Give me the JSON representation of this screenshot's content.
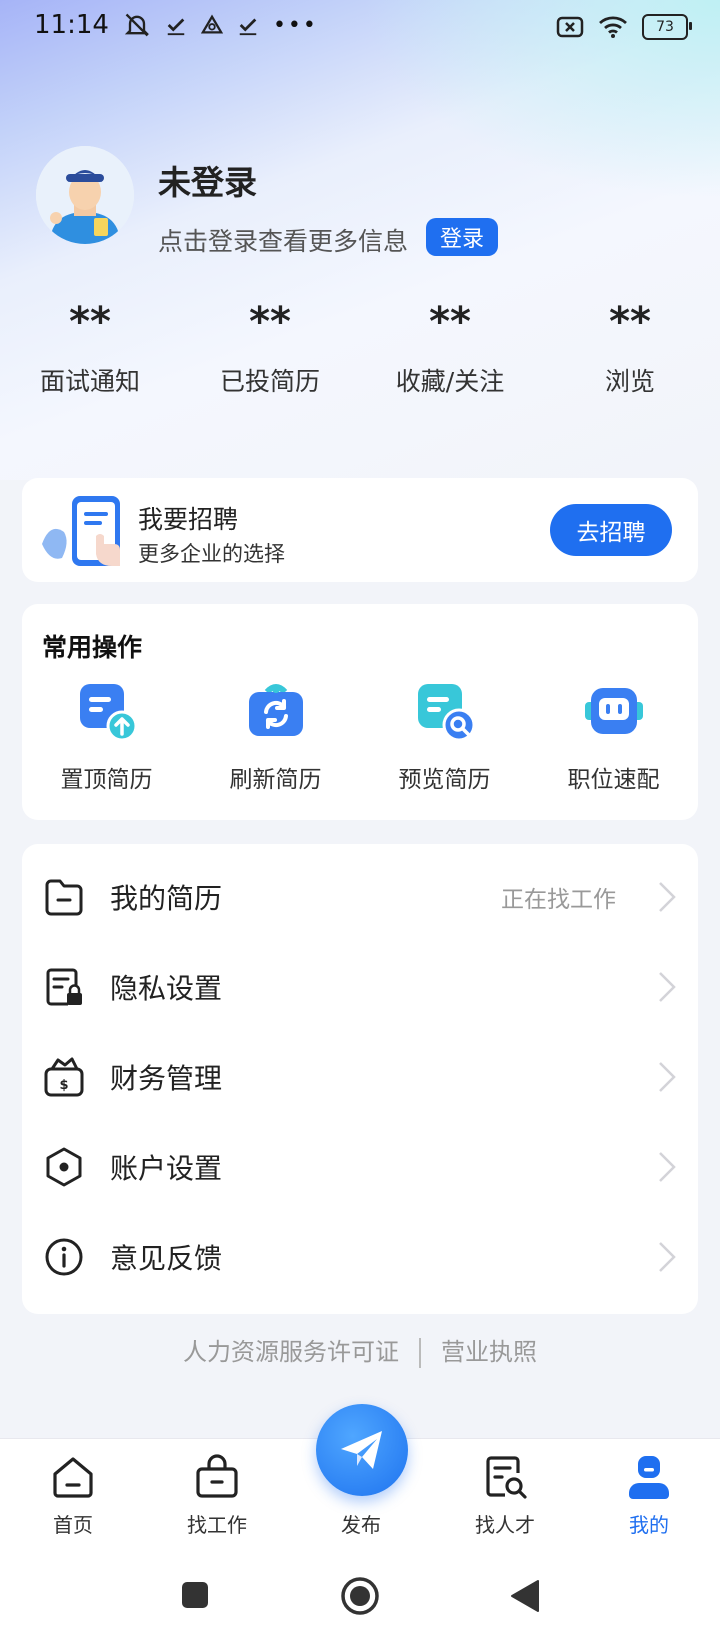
{
  "status_bar": {
    "time": "11:14",
    "battery": "73"
  },
  "profile": {
    "name": "未登录",
    "subtitle": "点击登录查看更多信息",
    "login_label": "登录"
  },
  "stats": [
    {
      "value": "**",
      "label": "面试通知"
    },
    {
      "value": "**",
      "label": "已投简历"
    },
    {
      "value": "**",
      "label": "收藏/关注"
    },
    {
      "value": "**",
      "label": "浏览"
    }
  ],
  "recruit": {
    "title": "我要招聘",
    "subtitle": "更多企业的选择",
    "button": "去招聘"
  },
  "common_ops": {
    "title": "常用操作",
    "items": [
      {
        "label": "置顶简历",
        "icon": "resume-top-icon"
      },
      {
        "label": "刷新简历",
        "icon": "resume-refresh-icon"
      },
      {
        "label": "预览简历",
        "icon": "resume-preview-icon"
      },
      {
        "label": "职位速配",
        "icon": "job-match-icon"
      }
    ]
  },
  "menu": [
    {
      "label": "我的简历",
      "right": "正在找工作",
      "icon": "folder-icon"
    },
    {
      "label": "隐私设置",
      "right": "",
      "icon": "privacy-lock-icon"
    },
    {
      "label": "财务管理",
      "right": "",
      "icon": "wallet-icon"
    },
    {
      "label": "账户设置",
      "right": "",
      "icon": "hexagon-settings-icon"
    },
    {
      "label": "意见反馈",
      "right": "",
      "icon": "info-icon"
    }
  ],
  "footer": {
    "license": "人力资源服务许可证",
    "business": "营业执照"
  },
  "tabs": [
    {
      "label": "首页",
      "icon": "home-icon"
    },
    {
      "label": "找工作",
      "icon": "briefcase-icon"
    },
    {
      "label": "发布",
      "icon": "paper-plane-icon"
    },
    {
      "label": "找人才",
      "icon": "talent-search-icon"
    },
    {
      "label": "我的",
      "icon": "user-icon",
      "active": true
    }
  ],
  "colors": {
    "accent": "#1f6ff0",
    "page_bg": "#f2f4f9"
  }
}
